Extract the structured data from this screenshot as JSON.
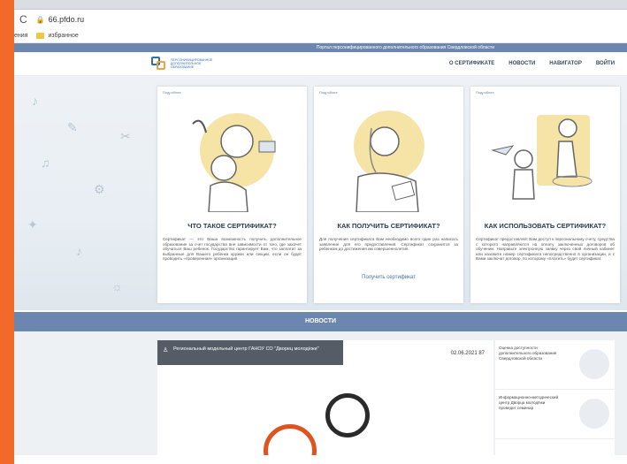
{
  "browser": {
    "url": "66.pfdo.ru",
    "bookmarks": [
      "ения",
      "избранное"
    ]
  },
  "site": {
    "portal_title": "Портал персонифицированного дополнительного образования Свердловской области",
    "nav": [
      "О СЕРТИФИКАТЕ",
      "НОВОСТИ",
      "НАВИГАТОР",
      "ВОЙТИ"
    ]
  },
  "cards": [
    {
      "more": "Подробнее",
      "title": "ЧТО ТАКОЕ СЕРТИФИКАТ?",
      "text": "Сертификат — это Ваша возможность получить дополнительное образование за счет государства вне зависимости от того, где захочет обучаться Ваш ребенок. Государство гарантирует Вам, что заплатит за выбранные для Вашего ребенка кружки или секции, если он будет проводить «проверенная» организация."
    },
    {
      "more": "Подробнее",
      "title": "КАК ПОЛУЧИТЬ СЕРТИФИКАТ?",
      "text": "Для получения сертификата Вам необходимо всего один раз написать заявление для его предоставления. Сертификат сохранится за ребенком до достижения им совершеннолетия.",
      "link": "Получить сертификат"
    },
    {
      "more": "Подробнее",
      "title": "КАК ИСПОЛЬЗОВАТЬ СЕРТИФИКАТ?",
      "text": "Сертификат предоставляет Вам доступ к персональному счету, средства с которого направляются на оплату заключенных договоров об обучении. Направьте электронную заявку через свой личный кабинет или назовите номер сертификата непосредственно в организации, и с Вами заключат договор, по которому «платить» будет сертификат."
    }
  ],
  "news": {
    "bar_label": "НОВОСТИ",
    "featured_tag": "Региональный модельный центр ГАНОУ СО \"Дворец молодёжи\"",
    "featured_meta": "02.06.2021   87",
    "side": [
      "Оценка доступности дополнительного образования Свердловской области",
      "Информационно-методический центр Дворца молодёжи проведет семинар"
    ]
  }
}
